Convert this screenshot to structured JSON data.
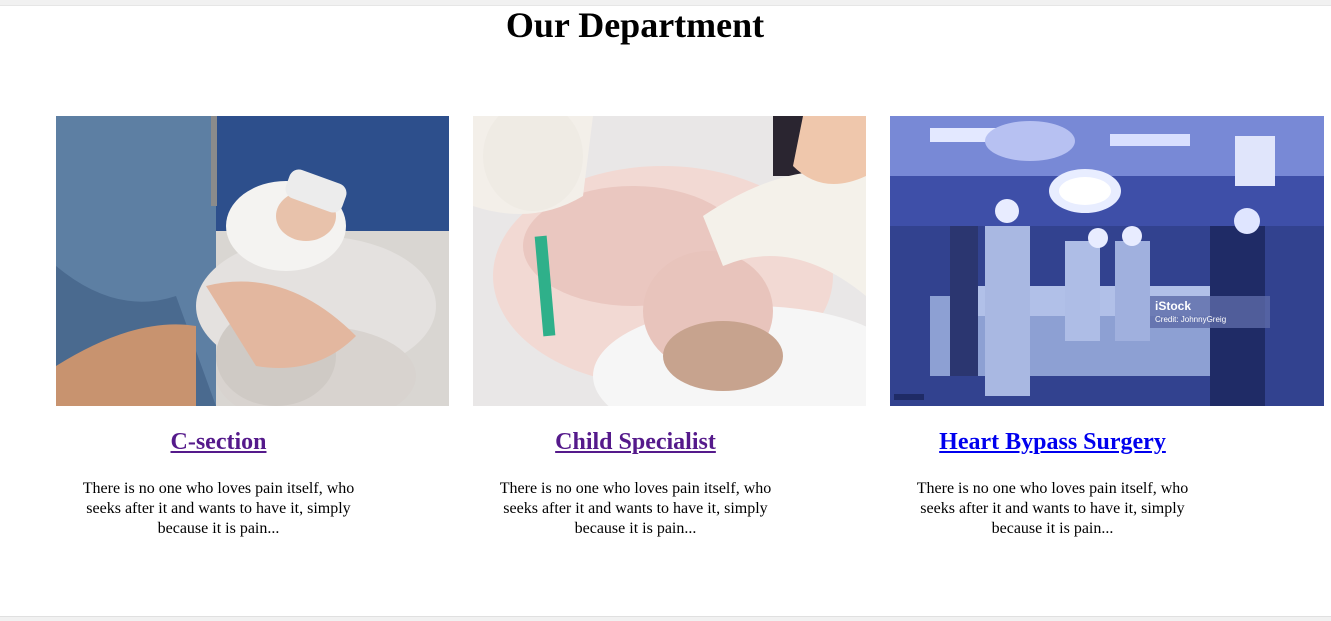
{
  "page": {
    "title": "Our Department"
  },
  "cards": [
    {
      "title": "C-section",
      "text": "There is no one who loves pain itself, who seeks after it and wants to have it, simply because it is pain...",
      "image_icon": "c-section-photo",
      "link_state": "visited"
    },
    {
      "title": "Child Specialist",
      "text": "There is no one who loves pain itself, who seeks after it and wants to have it, simply because it is pain...",
      "image_icon": "newborn-photo",
      "link_state": "visited"
    },
    {
      "title": "Heart Bypass Surgery",
      "text": "There is no one who loves pain itself, who seeks after it and wants to have it, simply because it is pain...",
      "image_icon": "operating-room-photo",
      "link_state": "unvisited",
      "watermark": "iStock",
      "watermark_credit": "Credit: JohnnyGreig"
    }
  ],
  "colors": {
    "visited_link": "#551a8b",
    "unvisited_link": "#0000ee"
  }
}
